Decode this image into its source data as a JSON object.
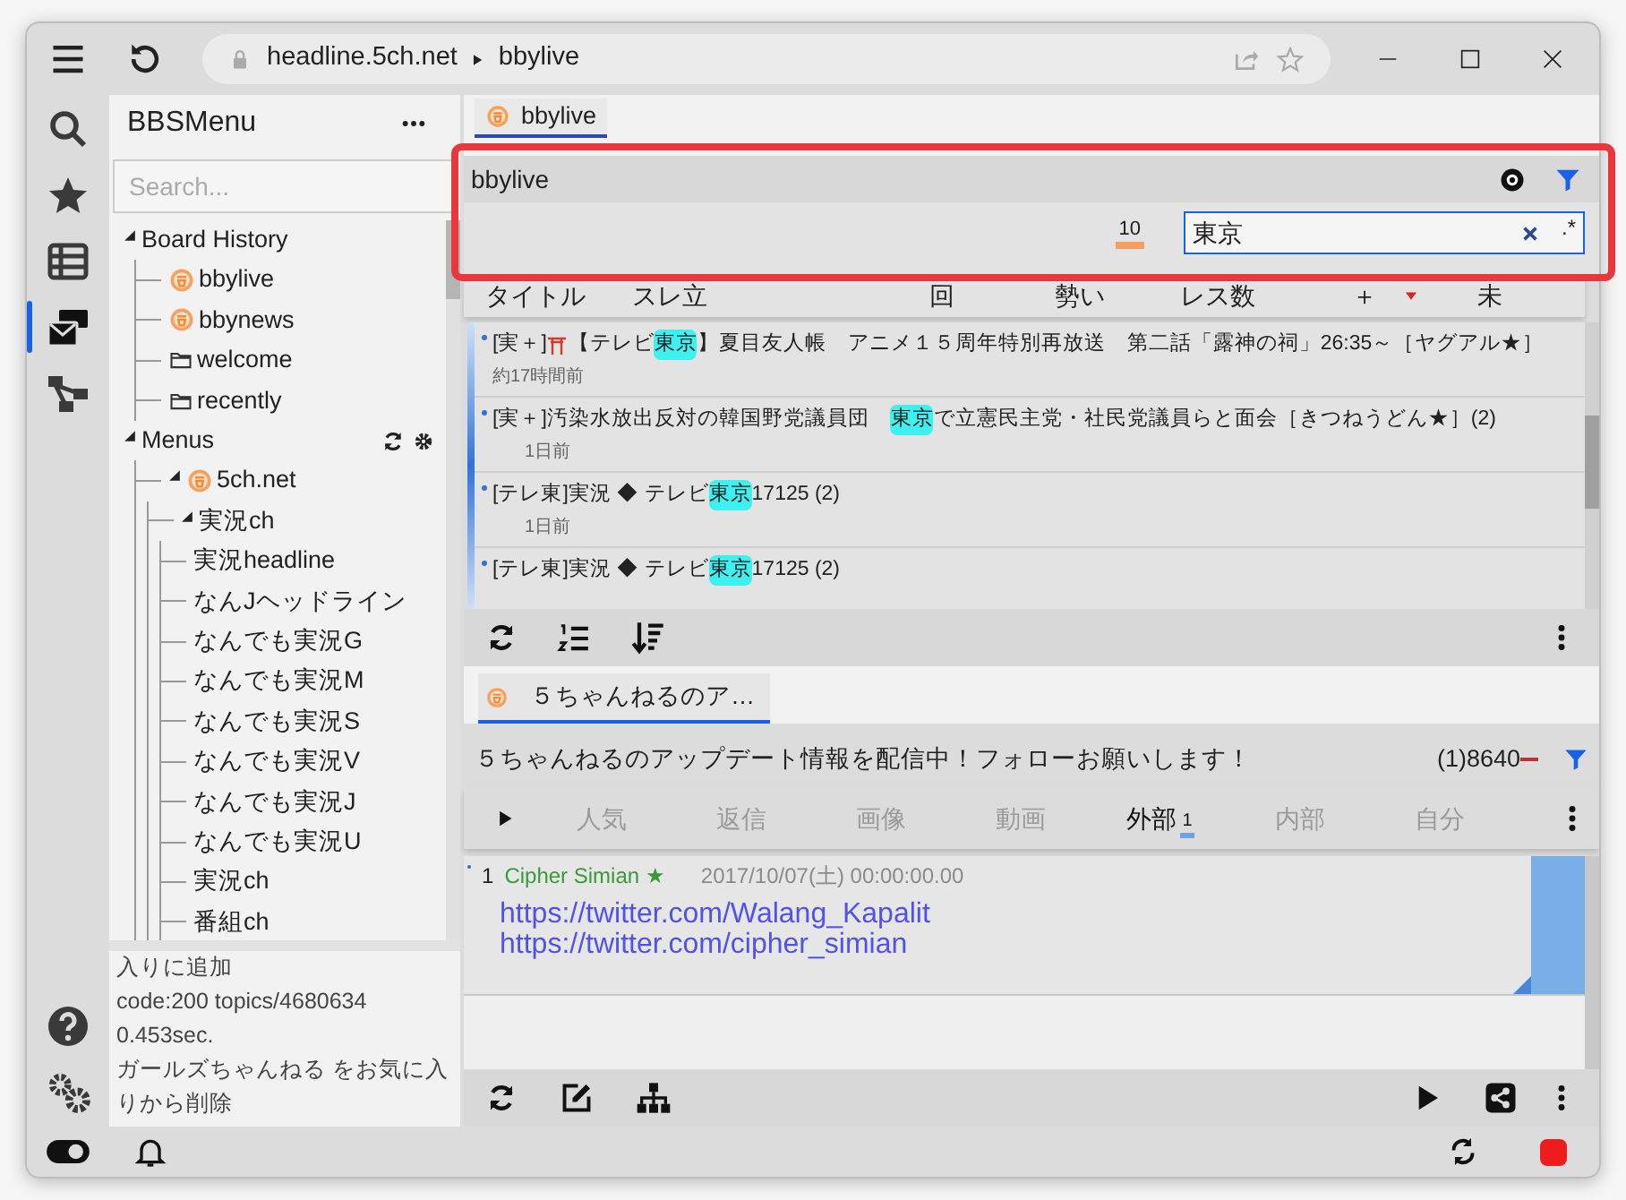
{
  "browser": {
    "host": "headline.5ch.net",
    "path": "bbylive"
  },
  "activity_bar": [
    {
      "kind": "search",
      "selected": false
    },
    {
      "kind": "favorites",
      "selected": false
    },
    {
      "kind": "list",
      "selected": false
    },
    {
      "kind": "boards",
      "selected": true
    },
    {
      "kind": "tree",
      "selected": false
    }
  ],
  "sidebar": {
    "title": "BBSMenu",
    "search": {
      "placeholder": "Search..."
    },
    "tree": [
      {
        "label": "Board History",
        "expanded": true,
        "children": [
          {
            "label": "bbylive",
            "kind": "board"
          },
          {
            "label": "bbynews",
            "kind": "board"
          },
          {
            "label": "welcome",
            "kind": "folder"
          },
          {
            "label": "recently",
            "kind": "folder"
          }
        ]
      },
      {
        "label": "Menus",
        "kind": "menus",
        "expanded": true,
        "children": [
          {
            "label": "5ch.net",
            "kind": "board",
            "expanded": true,
            "children": [
              {
                "label": "実況ch",
                "expanded": true,
                "children": [
                  {
                    "label": "実況headline"
                  },
                  {
                    "label": "なんJヘッドライン"
                  },
                  {
                    "label": "なんでも実況G"
                  },
                  {
                    "label": "なんでも実況M"
                  },
                  {
                    "label": "なんでも実況S"
                  },
                  {
                    "label": "なんでも実況V"
                  },
                  {
                    "label": "なんでも実況J"
                  },
                  {
                    "label": "なんでも実況U"
                  },
                  {
                    "label": "実況ch"
                  },
                  {
                    "label": "番組ch"
                  }
                ]
              }
            ]
          }
        ]
      }
    ],
    "log": [
      "入りに追加",
      "code:200 topics/4680634",
      "0.453sec.",
      "ガールズちゃんねる をお気に入りから削除"
    ]
  },
  "board_tabs": [
    {
      "label": "bbylive",
      "selected": true
    }
  ],
  "board_header": {
    "title": "bbylive"
  },
  "filter": {
    "count": "10",
    "query": "東京",
    "regex_label": ".*"
  },
  "columns": [
    "タイトル",
    "スレ立",
    "回",
    "勢い",
    "レス数",
    "＋",
    "未"
  ],
  "threads": [
    {
      "parts": [
        {
          "kind": "text",
          "text": "[実＋]"
        },
        {
          "kind": "torii"
        },
        {
          "kind": "text",
          "text": "【テレビ"
        },
        {
          "kind": "match",
          "text": "東京"
        },
        {
          "kind": "text",
          "text": "】夏目友人帳　アニメ１５周年特別再放送　第二話「露神の祠」26:35～［ヤグアル★］"
        }
      ],
      "age": "約17時間前"
    },
    {
      "parts": [
        {
          "kind": "text",
          "text": "[実＋]汚染水放出反対の韓国野党議員団　"
        },
        {
          "kind": "match",
          "text": "東京"
        },
        {
          "kind": "text",
          "text": "で立憲民主党・社民党議員らと面会［きつねうどん★］(2)"
        }
      ],
      "age": "1日前"
    },
    {
      "parts": [
        {
          "kind": "text",
          "text": "[テレ東]実況 ◆ テレビ"
        },
        {
          "kind": "match",
          "text": "東京"
        },
        {
          "kind": "text",
          "text": " 17125 (2)"
        }
      ],
      "age": "1日前"
    },
    {
      "parts": [
        {
          "kind": "text",
          "text": "[テレ東]実況 ◆ テレビ"
        },
        {
          "kind": "match",
          "text": "東京"
        },
        {
          "kind": "text",
          "text": " 17125 (2)"
        }
      ]
    }
  ],
  "thread_tabs": [
    {
      "label": "５ちゃんねるのア…",
      "selected": true
    }
  ],
  "thread_header": {
    "title": "５ちゃんねるのアップデート情報を配信中！フォローお願いします！",
    "count": "(1)8640"
  },
  "res_tabs": [
    {
      "label": "人気",
      "selected": false
    },
    {
      "label": "返信",
      "selected": false
    },
    {
      "label": "画像",
      "selected": false
    },
    {
      "label": "動画",
      "selected": false
    },
    {
      "label": "外部",
      "selected": true,
      "count": "1"
    },
    {
      "label": "内部",
      "selected": false
    },
    {
      "label": "自分",
      "selected": false
    }
  ],
  "posts": [
    {
      "number": "1",
      "name": "Cipher Simian ★",
      "date": "2017/10/07(土) 00:00:00.00",
      "links": [
        "https://twitter.com/Walang_Kapalit",
        "https://twitter.com/cipher_simian"
      ]
    }
  ]
}
